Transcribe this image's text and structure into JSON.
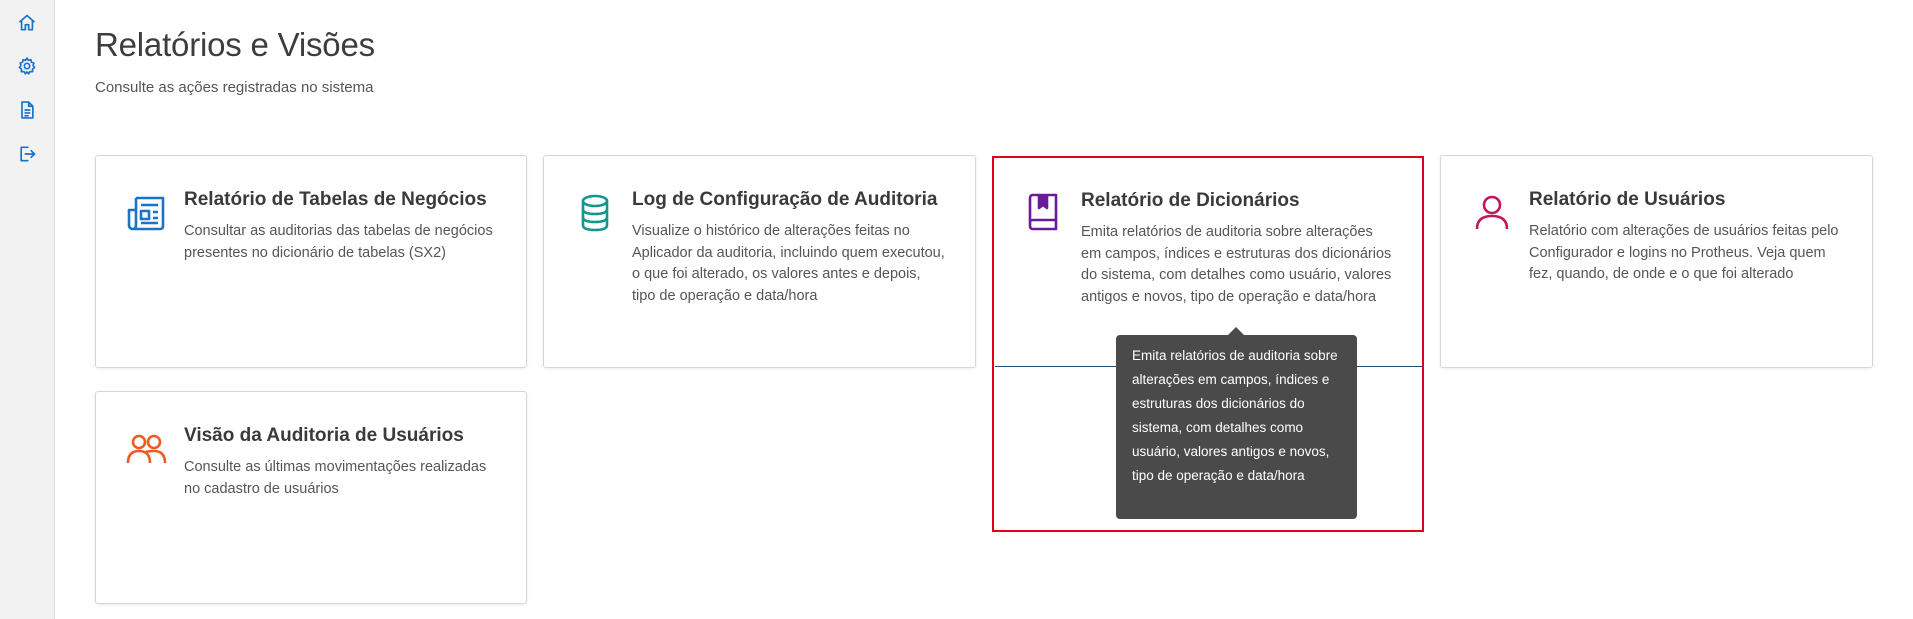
{
  "sidebar": {
    "items": [
      {
        "name": "home-icon"
      },
      {
        "name": "gear-icon"
      },
      {
        "name": "document-icon"
      },
      {
        "name": "logout-icon"
      }
    ]
  },
  "page": {
    "title": "Relatórios e Visões",
    "subtitle": "Consulte as ações registradas no sistema"
  },
  "cards": [
    {
      "title": "Relatório de Tabelas de Negócios",
      "description": "Consultar as auditorias das tabelas de negócios presentes no dicionário de tabelas (SX2)",
      "icon": "newspaper-icon",
      "color": "#1b73c9"
    },
    {
      "title": "Log de Configuração de Auditoria",
      "description": "Visualize o histórico de alterações feitas no Aplicador da auditoria, incluindo quem executou, o que foi alterado, os valores antes e depois, tipo de operação e data/hora",
      "icon": "database-icon",
      "color": "#12968c"
    },
    {
      "title": "Relatório de Dicionários",
      "description": "Emita relatórios de auditoria sobre alterações em campos, índices e estruturas dos dicionários do sistema, com detalhes como usuário, valores antigos e novos, tipo de operação e data/hora",
      "icon": "book-icon",
      "color": "#6a1b9a"
    },
    {
      "title": "Relatório de Usuários",
      "description": "Relatório com alterações de usuários feitas pelo Configurador e logins no Protheus. Veja quem fez, quando, de onde e o que foi alterado",
      "icon": "user-icon",
      "color": "#c2185b"
    },
    {
      "title": "Visão da Auditoria de Usuários",
      "description": "Consulte as últimas movimentações realizadas no cadastro de usuários",
      "icon": "users-icon",
      "color": "#f05a22"
    }
  ],
  "tooltip": {
    "text": "Emita relatórios de auditoria sobre alterações em campos, índices e estruturas dos dicionários do sistema, com detalhes como usuário, valores antigos e novos, tipo de operação e data/hora"
  },
  "colors": {
    "highlight": "#e0001b",
    "sidebar_icon": "#1b73c9"
  }
}
